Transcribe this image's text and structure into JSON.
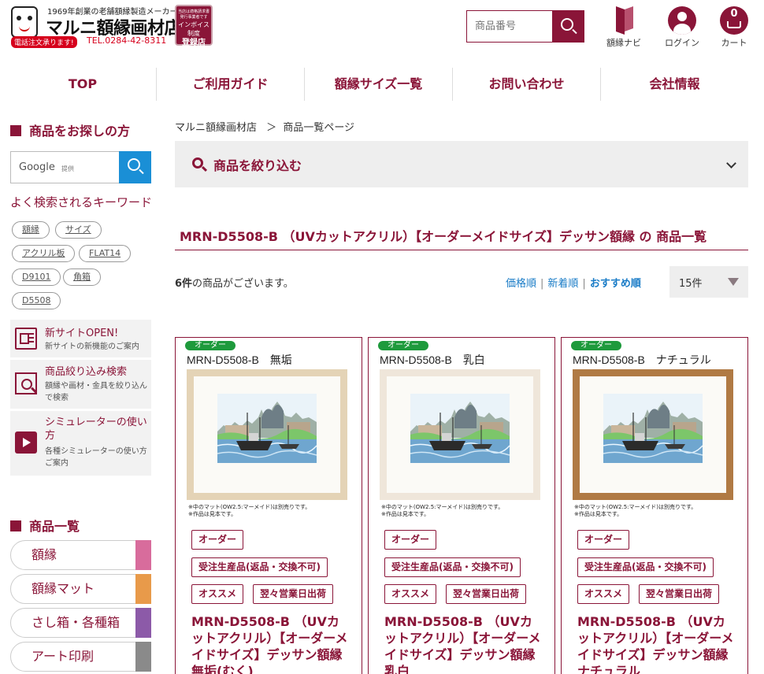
{
  "header": {
    "logo_tagline": "1969年創業の老舗額縁製造メーカー",
    "logo_name": "マルニ額縁画材店",
    "phone_badge": "電話注文承ります!",
    "tel": "TEL.0284-42-8311",
    "invoice_small": "当店は適格請求書発行事業者です",
    "invoice_mid": "インボイス制度",
    "invoice_big": "登録店",
    "search_placeholder": "商品番号",
    "icons": [
      {
        "label": "額縁ナビ",
        "icon": "book-icon"
      },
      {
        "label": "ログイン",
        "icon": "person-icon"
      },
      {
        "label": "カート",
        "icon": "cart-icon",
        "count": "0"
      }
    ]
  },
  "nav": [
    "TOP",
    "ご利用ガイド",
    "額縁サイズ一覧",
    "お問い合わせ",
    "会社情報"
  ],
  "sidebar": {
    "search_heading": "商品をお探しの方",
    "google_label": "Google",
    "google_provided": "提供",
    "keywords_title": "よく検索されるキーワード",
    "keywords": [
      "額縁",
      "サイズ",
      "アクリル板",
      "FLAT14",
      "D9101",
      "角箱",
      "D5508"
    ],
    "promos": [
      {
        "title": "新サイトOPEN!",
        "desc": "新サイトの新機能のご案内",
        "icon": "newspaper-icon"
      },
      {
        "title": "商品絞り込み検索",
        "desc": "額縁や画材・金具を絞り込んで検索",
        "icon": "filter-search-icon"
      },
      {
        "title": "シミュレーターの使い方",
        "desc": "各種シミュレーターの使い方ご案内",
        "icon": "play-icon"
      }
    ],
    "category_heading": "商品一覧",
    "categories": [
      {
        "label": "額縁",
        "color": "#d86c9c"
      },
      {
        "label": "額縁マット",
        "color": "#e89a4a"
      },
      {
        "label": "さし箱・各種箱",
        "color": "#8c5aa8"
      },
      {
        "label": "アート印刷",
        "color": "#8a8a8a"
      }
    ]
  },
  "main": {
    "breadcrumb": [
      "マルニ額縁画材店",
      "＞",
      "商品一覧ページ"
    ],
    "filter_label": "商品を絞り込む",
    "page_title": "MRN-D5508-B （UVカットアクリル）【オーダーメイドサイズ】デッサン額縁 の 商品一覧",
    "count_num": "6件",
    "count_text": "の商品がございます。",
    "sorts": [
      "価格順",
      "新着順",
      "おすすめ順"
    ],
    "per_page": "15件"
  },
  "products": [
    {
      "badge": "オーダー",
      "title": "MRN-D5508-B　無垢",
      "frame_color": "#e4d3b6",
      "notes": [
        "※中のマット(OW2.5:マーメイド)は別売りです。",
        "※作品は見本です。"
      ],
      "tags": [
        "オーダー",
        "受注生産品(返品・交換不可)",
        "オススメ",
        "翌々営業日出荷"
      ],
      "name": "MRN-D5508-B （UVカットアクリル）【オーダーメイドサイズ】デッサン額縁 無垢(むく)"
    },
    {
      "badge": "オーダー",
      "title": "MRN-D5508-B　乳白",
      "frame_color": "#efe6da",
      "notes": [
        "※中のマット(OW2.5:マーメイド)は別売りです。",
        "※作品は見本です。"
      ],
      "tags": [
        "オーダー",
        "受注生産品(返品・交換不可)",
        "オススメ",
        "翌々営業日出荷"
      ],
      "name": "MRN-D5508-B （UVカットアクリル）【オーダーメイドサイズ】デッサン額縁 乳白"
    },
    {
      "badge": "オーダー",
      "title": "MRN-D5508-B　ナチュラル",
      "frame_color": "#b07a44",
      "notes": [
        "※中のマット(OW2.5:マーメイド)は別売りです。",
        "※作品は見本です。"
      ],
      "tags": [
        "オーダー",
        "受注生産品(返品・交換不可)",
        "オススメ",
        "翌々営業日出荷"
      ],
      "name": "MRN-D5508-B （UVカットアクリル）【オーダーメイドサイズ】デッサン額縁 ナチュラル"
    }
  ]
}
